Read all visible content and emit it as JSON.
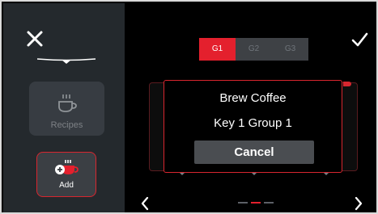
{
  "colors": {
    "accent": "#e4202d",
    "sidebar_bg": "#24292d",
    "main_bg": "#000000",
    "tile_bg": "#3e4349",
    "button_bg": "#4a4d51"
  },
  "sidebar": {
    "close_icon": "close-icon",
    "tiles": [
      {
        "label": "Recipes",
        "icon": "coffee-cup-icon",
        "enabled": false
      },
      {
        "label": "Add",
        "icon": "add-coffee-icon",
        "enabled": true
      }
    ]
  },
  "header": {
    "groups": [
      {
        "label": "G1",
        "active": true
      },
      {
        "label": "G2",
        "active": false
      },
      {
        "label": "G3",
        "active": false
      }
    ],
    "confirm_icon": "checkmark-icon"
  },
  "dialog": {
    "title": "Brew Coffee",
    "subtitle": "Key 1 Group 1",
    "cancel_label": "Cancel"
  },
  "footer": {
    "prev_icon": "chevron-left-icon",
    "next_icon": "chevron-right-icon",
    "page_count": 3,
    "current_page": 2
  }
}
